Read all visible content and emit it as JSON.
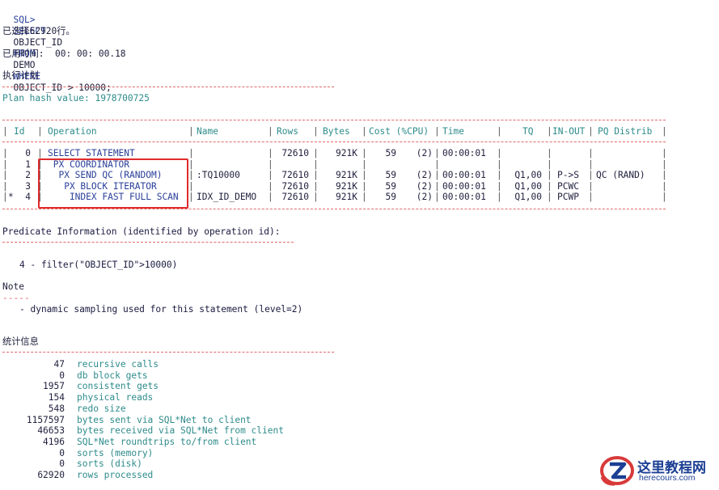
{
  "query": {
    "prompt": "SQL>",
    "select_kw": "SELECT",
    "column": "OBJECT_ID",
    "from_kw": "FROM",
    "table": "DEMO",
    "where_kw": "WHERE",
    "condition": "OBJECT_ID > 10000;"
  },
  "result": {
    "rows_selected": "已选择62920行。",
    "elapsed_label": "已用时间:",
    "elapsed_value": "00: 00: 00.18"
  },
  "plan": {
    "title": "执行计划",
    "hash": "Plan hash value: 1978700725",
    "headers": {
      "id": "Id",
      "operation": "Operation",
      "name": "Name",
      "rows": "Rows",
      "bytes": "Bytes",
      "cost": "Cost (%CPU)",
      "time": "Time",
      "tq": "TQ",
      "inout": "IN-OUT",
      "pq": "PQ Distrib"
    },
    "rows": [
      {
        "mark": "",
        "id": "0",
        "operation": "SELECT STATEMENT",
        "name": "",
        "rows": "72610",
        "bytes": "921K",
        "cost": "59",
        "cpu": "(2)",
        "time": "00:00:01",
        "tq": "",
        "inout": "",
        "pq": ""
      },
      {
        "mark": "",
        "id": "1",
        "operation": " PX COORDINATOR",
        "name": "",
        "rows": "",
        "bytes": "",
        "cost": "",
        "cpu": "",
        "time": "",
        "tq": "",
        "inout": "",
        "pq": ""
      },
      {
        "mark": "",
        "id": "2",
        "operation": "  PX SEND QC (RANDOM)",
        "name": ":TQ10000",
        "rows": "72610",
        "bytes": "921K",
        "cost": "59",
        "cpu": "(2)",
        "time": "00:00:01",
        "tq": "Q1,00",
        "inout": "P->S",
        "pq": "QC (RAND)"
      },
      {
        "mark": "",
        "id": "3",
        "operation": "   PX BLOCK ITERATOR",
        "name": "",
        "rows": "72610",
        "bytes": "921K",
        "cost": "59",
        "cpu": "(2)",
        "time": "00:00:01",
        "tq": "Q1,00",
        "inout": "PCWC",
        "pq": ""
      },
      {
        "mark": "*",
        "id": "4",
        "operation": "    INDEX FAST FULL SCAN",
        "name": "IDX_ID_DEMO",
        "rows": "72610",
        "bytes": "921K",
        "cost": "59",
        "cpu": "(2)",
        "time": "00:00:01",
        "tq": "Q1,00",
        "inout": "PCWP",
        "pq": ""
      }
    ]
  },
  "predicate": {
    "title": "Predicate Information (identified by operation id):",
    "line": "4 - filter(\"OBJECT_ID\">10000)"
  },
  "note": {
    "title": "Note",
    "underline": "-----",
    "line": "- dynamic sampling used for this statement (level=2)"
  },
  "stats": {
    "title": "统计信息",
    "items": [
      {
        "value": "47",
        "label": "recursive calls"
      },
      {
        "value": "0",
        "label": "db block gets"
      },
      {
        "value": "1957",
        "label": "consistent gets"
      },
      {
        "value": "154",
        "label": "physical reads"
      },
      {
        "value": "548",
        "label": "redo size"
      },
      {
        "value": "1157597",
        "label": "bytes sent via SQL*Net to client"
      },
      {
        "value": "46653",
        "label": "bytes received via SQL*Net from client"
      },
      {
        "value": "4196",
        "label": "SQL*Net roundtrips to/from client"
      },
      {
        "value": "0",
        "label": "sorts (memory)"
      },
      {
        "value": "0",
        "label": "sorts (disk)"
      },
      {
        "value": "62920",
        "label": "rows processed"
      }
    ]
  },
  "watermark": {
    "name": "这里教程网",
    "url": "herecours.com"
  }
}
